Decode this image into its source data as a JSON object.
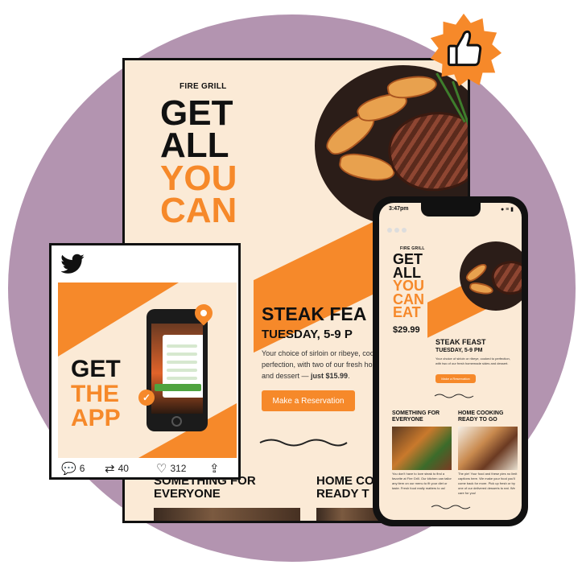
{
  "flyer": {
    "brand": "FIRE GRILL",
    "headline": [
      "GET",
      "ALL",
      "YOU",
      "CAN"
    ],
    "feast_title": "STEAK FEA",
    "feast_sub": "TUESDAY, 5-9 P",
    "desc_lines": [
      "Your choice of sirloin or ribeye, cook",
      "perfection, with two of our fresh hom",
      "and dessert — "
    ],
    "price_note": "just $15.99",
    "cta": "Make a Reservation",
    "section_left": [
      "SOMETHING FOR",
      "EVERYONE"
    ],
    "section_right": [
      "HOME CO",
      "READY T"
    ]
  },
  "tweet": {
    "promo": [
      "GET",
      "THE",
      "APP"
    ],
    "replies": "6",
    "retweets": "40",
    "likes": "312"
  },
  "phone": {
    "time": "3:47pm",
    "status": "● ≡ ▮",
    "brand": "FIRE GRILL",
    "headline": [
      "GET",
      "ALL",
      "YOU",
      "CAN",
      "EAT"
    ],
    "price": "$29.99",
    "feast_title": "STEAK FEAST",
    "feast_sub": "TUESDAY, 5-9 PM",
    "desc": "Your choice of sirloin or ribeye, cooked to perfection, with two of our fresh homemade sides and dessert.",
    "cta": "Make a Reservation",
    "section_left": [
      "SOMETHING FOR",
      "EVERYONE"
    ],
    "section_right": [
      "HOME COOKING",
      "READY TO GO"
    ],
    "text_left": "You don't have to love steak to find a favorite at Fire Grill. Our kitchen can tailor any item on our menu to fit your diet or taste. Fresh food really matters to us!",
    "text_right": "The pie! Your food and these pies no limit captions here. We make your food you'll come back for more. Pick up fresh or try one of our delivered desserts to eat. We care for you!"
  },
  "badge": {
    "icon": "thumbs-up-icon"
  },
  "colors": {
    "accent": "#f6892a",
    "cream": "#fbead6",
    "circle": "#b394b0",
    "ink": "#111111"
  }
}
